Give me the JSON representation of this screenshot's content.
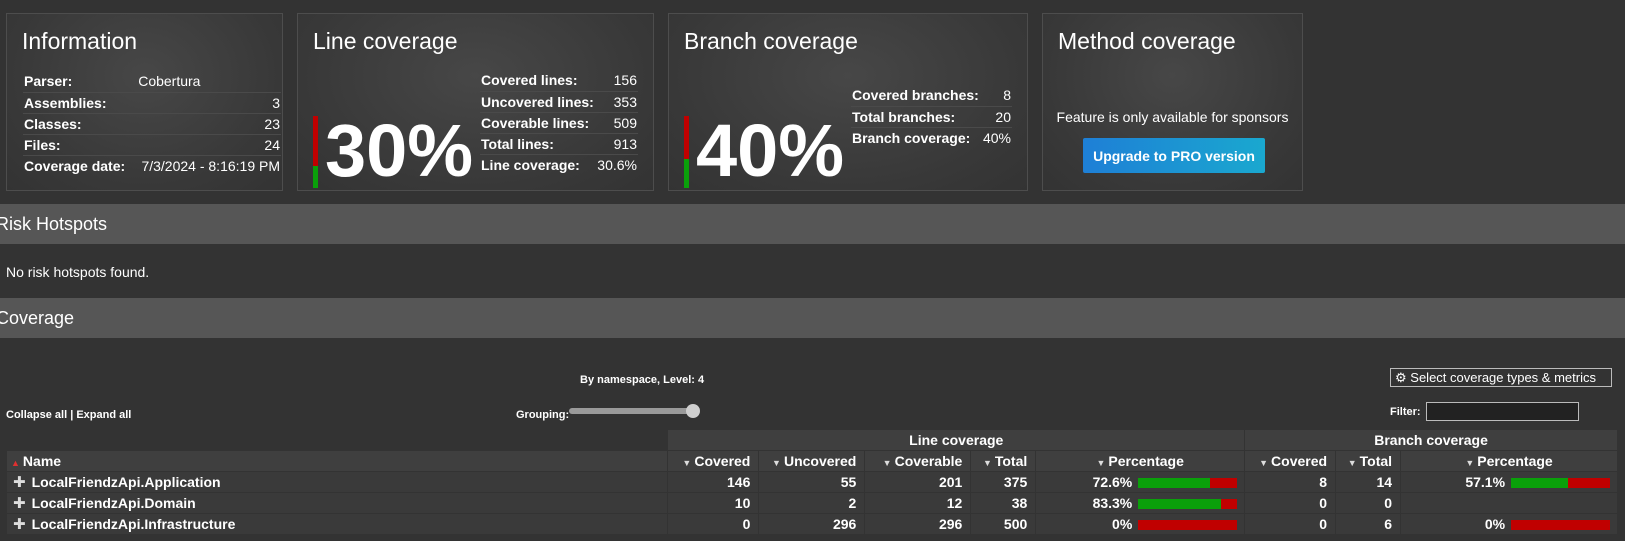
{
  "information": {
    "title": "Information",
    "rows": [
      {
        "label": "Parser:",
        "value": "Cobertura"
      },
      {
        "label": "Assemblies:",
        "value": "3"
      },
      {
        "label": "Classes:",
        "value": "23"
      },
      {
        "label": "Files:",
        "value": "24"
      },
      {
        "label": "Coverage date:",
        "value": "7/3/2024 - 8:16:19 PM"
      }
    ]
  },
  "line_coverage": {
    "title": "Line coverage",
    "big": "30%",
    "fraction": 0.306,
    "rows": [
      {
        "label": "Covered lines:",
        "value": "156"
      },
      {
        "label": "Uncovered lines:",
        "value": "353"
      },
      {
        "label": "Coverable lines:",
        "value": "509"
      },
      {
        "label": "Total lines:",
        "value": "913"
      },
      {
        "label": "Line coverage:",
        "value": "30.6%"
      }
    ]
  },
  "branch_coverage": {
    "title": "Branch coverage",
    "big": "40%",
    "fraction": 0.4,
    "rows": [
      {
        "label": "Covered branches:",
        "value": "8"
      },
      {
        "label": "Total branches:",
        "value": "20"
      },
      {
        "label": "Branch coverage:",
        "value": "40%"
      }
    ]
  },
  "method_coverage": {
    "title": "Method coverage",
    "text": "Feature is only available for sponsors",
    "button": "Upgrade to PRO version"
  },
  "risk": {
    "title": "Risk Hotspots",
    "text": "No risk hotspots found."
  },
  "coverage": {
    "title": "Coverage",
    "collapse_all": "Collapse all",
    "separator": "|",
    "expand_all": "Expand all",
    "grouping_label": "Grouping:",
    "grouping_value": "By namespace, Level: 4",
    "select_button": "Select coverage types & metrics",
    "filter_label": "Filter:",
    "filter_value": "",
    "group_headers": {
      "line": "Line coverage",
      "branch": "Branch coverage"
    },
    "headers": {
      "name": "Name",
      "covered": "Covered",
      "uncovered": "Uncovered",
      "coverable": "Coverable",
      "total": "Total",
      "percentage": "Percentage",
      "b_covered": "Covered",
      "b_total": "Total",
      "b_percentage": "Percentage"
    },
    "rows": [
      {
        "name": "LocalFriendzApi.Application",
        "covered": "146",
        "uncovered": "55",
        "coverable": "201",
        "total": "375",
        "pct": "72.6%",
        "line_frac": 0.726,
        "b_covered": "8",
        "b_total": "14",
        "b_pct": "57.1%",
        "branch_frac": 0.571
      },
      {
        "name": "LocalFriendzApi.Domain",
        "covered": "10",
        "uncovered": "2",
        "coverable": "12",
        "total": "38",
        "pct": "83.3%",
        "line_frac": 0.833,
        "b_covered": "0",
        "b_total": "0",
        "b_pct": "",
        "branch_frac": null
      },
      {
        "name": "LocalFriendzApi.Infrastructure",
        "covered": "0",
        "uncovered": "296",
        "coverable": "296",
        "total": "500",
        "pct": "0%",
        "line_frac": 0,
        "b_covered": "0",
        "b_total": "6",
        "b_pct": "0%",
        "branch_frac": 0
      }
    ]
  },
  "colors": {
    "covered": "#0aa00a",
    "uncovered": "#c00000",
    "button": "#1e7fd6"
  },
  "icons": {
    "settings": "gear-icon",
    "expand": "plus-icon",
    "sort": "triangle-down-icon"
  }
}
